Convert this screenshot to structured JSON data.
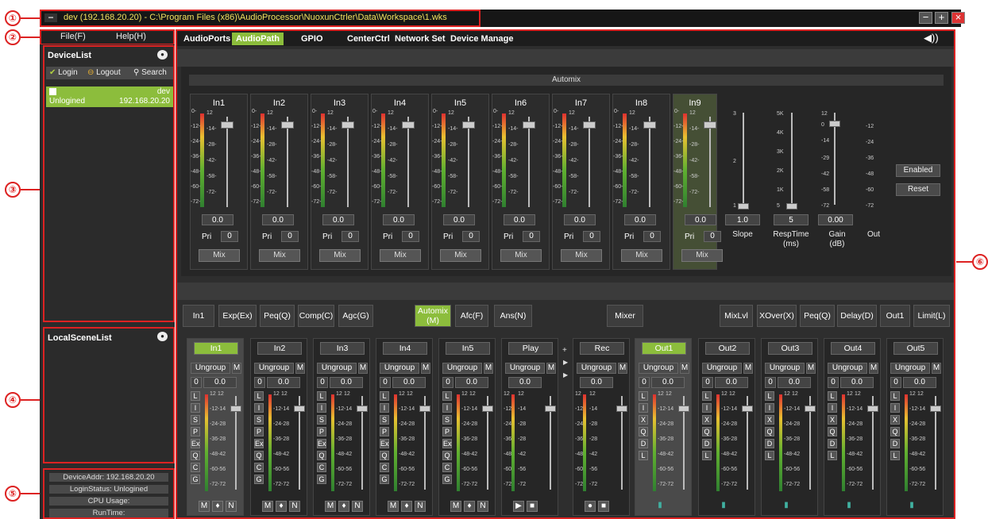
{
  "callouts": [
    "①",
    "②",
    "③",
    "④",
    "⑤",
    "⑥"
  ],
  "titlebar": {
    "title": "dev (192.168.20.20) - C:\\Program Files (x86)\\AudioProcessor\\NuoxunCtrler\\Data\\Workspace\\1.wks",
    "logo": "logo-icon"
  },
  "menu": {
    "file": "File(F)",
    "help": "Help(H)"
  },
  "devicelist": {
    "title": "DeviceList",
    "login": "Login",
    "logout": "Logout",
    "search": "Search",
    "device_name": "dev",
    "device_status": "Unlogined",
    "device_ip": "192.168.20.20"
  },
  "localscene": {
    "title": "LocalSceneList"
  },
  "status": {
    "addr": "DeviceAddr: 192.168.20.20",
    "login": "LoginStatus: Unlogined",
    "cpu": "CPU Usage:",
    "runtime": "RunTime:"
  },
  "tabs": [
    "AudioPorts",
    "AudioPath",
    "GPIO",
    "CenterCtrl",
    "Network Set",
    "Device Manage"
  ],
  "automix": {
    "title": "Automix",
    "strips": [
      "In1",
      "In2",
      "In3",
      "In4",
      "In5",
      "In6",
      "In7",
      "In8",
      "In9"
    ],
    "gain": "0.0",
    "pri_label": "Pri",
    "pri_value": "0",
    "mix_label": "Mix",
    "meter_scale": [
      "12",
      "-14-",
      "-28-",
      "-42-",
      "-58-",
      "-72-"
    ],
    "fader_scale": [
      "0-",
      "-12-",
      "-24-",
      "-36-",
      "-48-",
      "-60-",
      "-72-"
    ],
    "slope": {
      "value": "1.0",
      "label": "Slope",
      "scale": [
        "3",
        "2",
        "1"
      ]
    },
    "resp": {
      "value": "5",
      "label": "RespTime",
      "unit": "(ms)",
      "scale": [
        "5K",
        "4K",
        "3K",
        "2K",
        "1K",
        "5"
      ]
    },
    "gain_ctl": {
      "value": "0.00",
      "label": "Gain",
      "unit": "(dB)",
      "scale": [
        "12",
        "0",
        "-14",
        "-29",
        "-42",
        "-58",
        "-72"
      ]
    },
    "out": {
      "label": "Out",
      "scale": [
        "-12",
        "-24",
        "-36",
        "-48",
        "-60",
        "-72"
      ]
    },
    "enabled": "Enabled",
    "reset": "Reset"
  },
  "modules": [
    "In1",
    "Exp(Ex)",
    "Peq(Q)",
    "Comp(C)",
    "Agc(G)",
    "Automix (M)",
    "Afc(F)",
    "Ans(N)",
    "Mixer",
    "MixLvl",
    "XOver(X)",
    "Peq(Q)",
    "Delay(D)",
    "Out1",
    "Limit(L)"
  ],
  "bottom_strips": [
    {
      "name": "In1",
      "keys": [
        "L",
        "I",
        "S",
        "P",
        "Ex",
        "Q",
        "C",
        "G"
      ],
      "foot": [
        "M",
        "mic",
        "N"
      ]
    },
    {
      "name": "In2",
      "keys": [
        "L",
        "I",
        "S",
        "P",
        "Ex",
        "Q",
        "C",
        "G"
      ],
      "foot": [
        "M",
        "mic",
        "N"
      ]
    },
    {
      "name": "In3",
      "keys": [
        "L",
        "I",
        "S",
        "P",
        "Ex",
        "Q",
        "C",
        "G"
      ],
      "foot": [
        "M",
        "mic",
        "N"
      ]
    },
    {
      "name": "In4",
      "keys": [
        "L",
        "I",
        "S",
        "P",
        "Ex",
        "Q",
        "C",
        "G"
      ],
      "foot": [
        "M",
        "mic",
        "N"
      ]
    },
    {
      "name": "In5",
      "keys": [
        "L",
        "I",
        "S",
        "P",
        "Ex",
        "Q",
        "C",
        "G"
      ],
      "foot": [
        "M",
        "mic",
        "N"
      ]
    },
    {
      "name": "Play",
      "keys": [],
      "foot": [
        "play",
        "stop"
      ]
    },
    {
      "name": "Rec",
      "keys": [],
      "foot": [
        "rec",
        "stop"
      ]
    },
    {
      "name": "Out1",
      "keys": [
        "L",
        "I",
        "X",
        "Q",
        "D",
        "L"
      ],
      "foot": [
        "meter"
      ]
    },
    {
      "name": "Out2",
      "keys": [
        "L",
        "I",
        "X",
        "Q",
        "D",
        "L"
      ],
      "foot": [
        "meter"
      ]
    },
    {
      "name": "Out3",
      "keys": [
        "L",
        "I",
        "X",
        "Q",
        "D",
        "L"
      ],
      "foot": [
        "meter"
      ]
    },
    {
      "name": "Out4",
      "keys": [
        "L",
        "I",
        "X",
        "Q",
        "D",
        "L"
      ],
      "foot": [
        "meter"
      ]
    },
    {
      "name": "Out5",
      "keys": [
        "L",
        "I",
        "X",
        "Q",
        "D",
        "L"
      ],
      "foot": [
        "meter"
      ]
    }
  ],
  "ungroup": "Ungroup",
  "m": "M",
  "zero": "0",
  "gain0": "0.0",
  "scale_b": [
    "12",
    "-12",
    "-24",
    "-36",
    "-48",
    "-60",
    "-72"
  ],
  "scale_b2": [
    "12",
    "-14",
    "-28",
    "-28",
    "-42",
    "-56",
    "-72"
  ],
  "colors": {
    "accent": "#8cbd3c",
    "callout": "#dd2222",
    "title": "#f0e060"
  }
}
